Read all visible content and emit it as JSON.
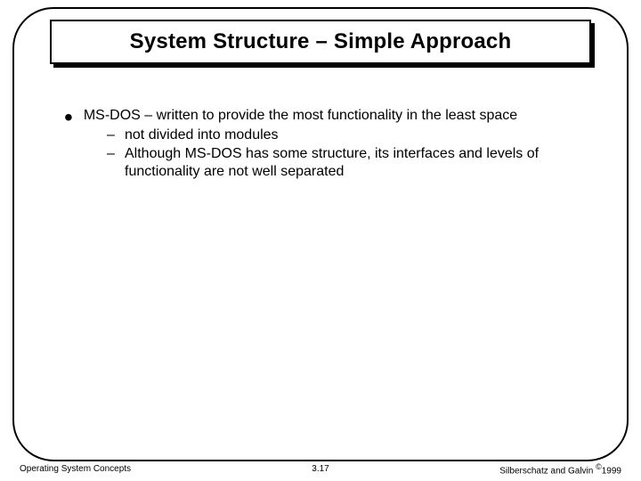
{
  "title": "System Structure – Simple Approach",
  "bullets": [
    {
      "text": "MS-DOS – written to provide the most functionality in the least space",
      "subs": [
        "not divided into modules",
        "Although MS-DOS has some structure, its interfaces and levels of functionality are not well separated"
      ]
    }
  ],
  "footer": {
    "left": "Operating System Concepts",
    "center": "3.17",
    "right_prefix": "Silberschatz and Galvin ",
    "right_symbol": "©",
    "right_year": "1999"
  }
}
